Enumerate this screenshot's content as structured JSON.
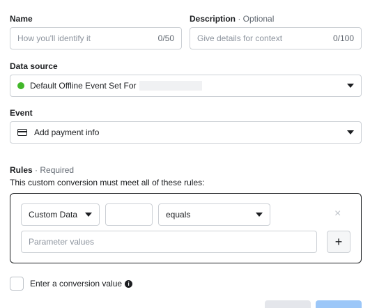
{
  "name": {
    "label": "Name",
    "placeholder": "How you'll identify it",
    "counter": "0/50"
  },
  "description": {
    "label": "Description",
    "optional": " · Optional",
    "placeholder": "Give details for context",
    "counter": "0/100"
  },
  "data_source": {
    "label": "Data source",
    "value": "Default Offline Event Set For",
    "status_color": "#42b72a"
  },
  "event": {
    "label": "Event",
    "value": "Add payment info",
    "icon": "credit-card-icon"
  },
  "rules": {
    "label": "Rules",
    "required": " · Required",
    "description": "This custom conversion must meet all of these rules:",
    "rule": {
      "field_select": "Custom Data",
      "key_value": "",
      "operator_select": "equals",
      "parameter_placeholder": "Parameter values",
      "add_symbol": "+",
      "remove_symbol": "×"
    }
  },
  "conversion_value": {
    "label": "Enter a conversion value",
    "info_symbol": "i"
  }
}
